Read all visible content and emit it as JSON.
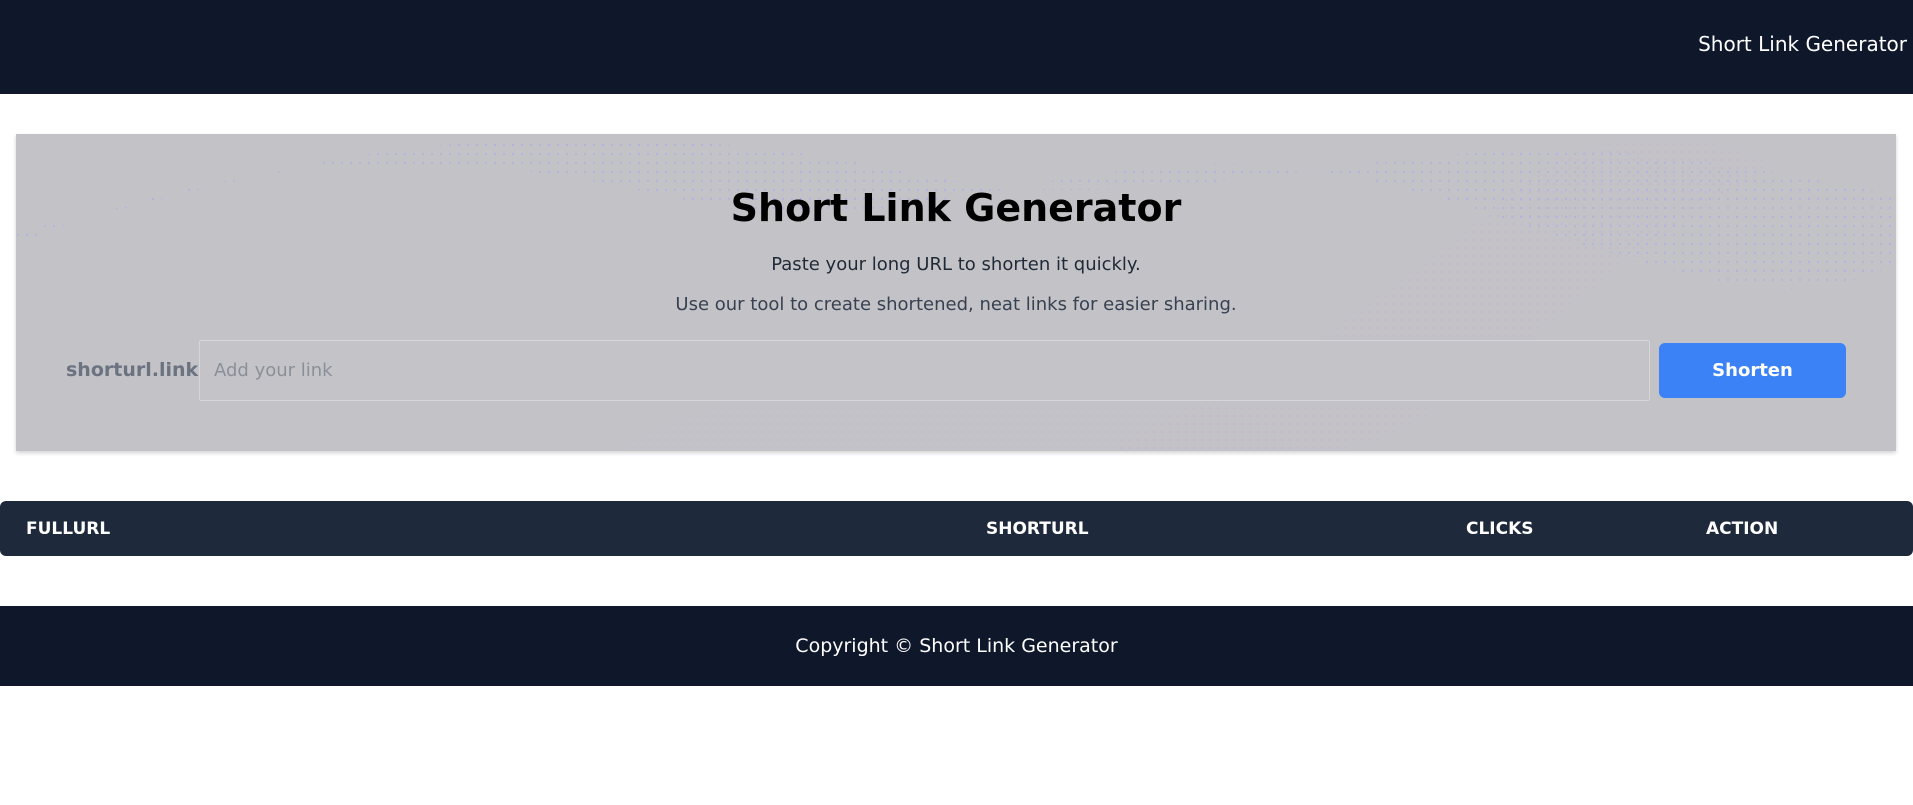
{
  "header": {
    "brand": "Short Link Generator"
  },
  "hero": {
    "title": "Short Link Generator",
    "subtitle": "Paste your long URL to shorten it quickly.",
    "description": "Use our tool to create shortened, neat links for easier sharing.",
    "prefix": "shorturl.link /",
    "input_value": "",
    "input_placeholder": "Add your link",
    "button_label": "Shorten"
  },
  "table": {
    "columns": [
      "FULLURL",
      "SHORTURL",
      "CLICKS",
      "ACTION"
    ],
    "rows": []
  },
  "footer": {
    "copyright": "Copyright © Short Link Generator"
  },
  "colors": {
    "nav_bg": "#0f172a",
    "table_header_bg": "#1e293b",
    "accent": "#3b82f6",
    "hero_bg": "#c3c3c7"
  }
}
